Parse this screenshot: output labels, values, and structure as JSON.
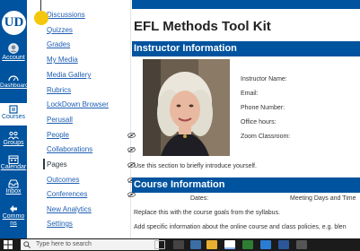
{
  "global_nav": {
    "logo": "UD",
    "items": [
      {
        "label": "Account",
        "icon": "account-icon"
      },
      {
        "label": "Dashboard",
        "icon": "dashboard-icon"
      },
      {
        "label": "Courses",
        "icon": "courses-icon"
      },
      {
        "label": "Groups",
        "icon": "groups-icon"
      },
      {
        "label": "Calendar",
        "icon": "calendar-icon"
      },
      {
        "label": "Inbox",
        "icon": "inbox-icon"
      },
      {
        "label": "Commons",
        "icon": "commons-icon"
      }
    ]
  },
  "course_nav": {
    "items": [
      {
        "label": "Discussions"
      },
      {
        "label": "Quizzes"
      },
      {
        "label": "Grades"
      },
      {
        "label": "My Media"
      },
      {
        "label": "Media Gallery"
      },
      {
        "label": "Rubrics"
      },
      {
        "label": "LockDown Browser"
      },
      {
        "label": "Perusall"
      },
      {
        "label": "People",
        "icon": "eye-slash-icon"
      },
      {
        "label": "Collaborations",
        "icon": "eye-slash-icon"
      },
      {
        "label": "Pages",
        "icon": "eye-slash-icon",
        "current": true
      },
      {
        "label": "Outcomes",
        "icon": "eye-slash-icon"
      },
      {
        "label": "Conferences",
        "icon": "eye-slash-icon"
      },
      {
        "label": "New Analytics"
      },
      {
        "label": "Settings"
      }
    ]
  },
  "content": {
    "title": "EFL Methods Tool Kit",
    "instructor_heading": "Instructor Information",
    "fields": {
      "name": "Instructor Name:",
      "email": "Email:",
      "phone": "Phone Number:",
      "office": "Office hours:",
      "zoom": "Zoom Classroom:"
    },
    "intro_text": "Use this section to briefly introduce yourself.",
    "course_heading": "Course Information",
    "dates_label": "Dates:",
    "meeting_label": "Meeting Days and Time",
    "goals_text": "Replace this with the course goals from the syllabus.",
    "policies_text": "Add specific information about the online course and class policies, e.g. blen"
  },
  "taskbar": {
    "search_placeholder": "Type here to search"
  },
  "colors": {
    "brand": "#00539f",
    "link": "#1f5fb3",
    "taskbar": "#1b1b1b"
  }
}
